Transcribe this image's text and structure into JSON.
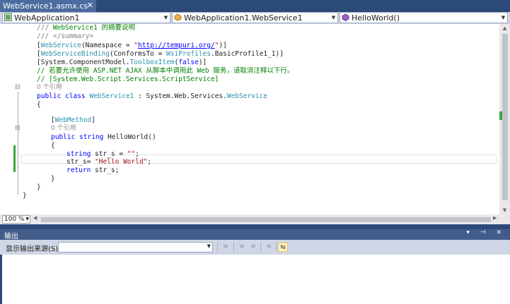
{
  "tab": {
    "title": "WebService1.asmx.cs",
    "close": "✕"
  },
  "nav": {
    "project": "WebApplication1",
    "type": "WebApplication1.WebService1",
    "member": "HelloWorld()"
  },
  "code": {
    "l1": {
      "a": "/// ",
      "b": "WebService1 的摘要说明"
    },
    "l2": "/// </summary>",
    "l3": {
      "a": "[",
      "b": "WebService",
      "c": "(Namespace = ",
      "d": "\"",
      "e": "http://tempuri.org/",
      "f": "\"",
      "g": ")]"
    },
    "l4": {
      "a": "[",
      "b": "WebServiceBinding",
      "c": "(ConformsTo = ",
      "d": "WsiProfiles",
      "e": ".BasicProfile1_1)]"
    },
    "l5": {
      "a": "[System.ComponentModel.",
      "b": "ToolboxItem",
      "c": "(",
      "d": "false",
      "e": ")]"
    },
    "l6": "// 若要允许使用 ASP.NET AJAX 从脚本中调用此 Web 服务，请取消注释以下行。",
    "l7": "// [System.Web.Script.Services.ScriptService]",
    "lens1": "0 个引用",
    "l8": {
      "a": "public class ",
      "b": "WebService1",
      "c": " : System.Web.Services.",
      "d": "WebService"
    },
    "l9": "{",
    "l10": {
      "a": "[",
      "b": "WebMethod",
      "c": "]"
    },
    "lens2": "0 个引用",
    "l11": {
      "a": "public string ",
      "b": "HelloWorld()"
    },
    "l12": "{",
    "l13": {
      "a": "string ",
      "b": "str_s = ",
      "c": "\"\"",
      "d": ";"
    },
    "l14": {
      "a": "str_s= ",
      "b": "\"Hello World\"",
      "c": ";"
    },
    "l15": {
      "a": "return ",
      "b": "str_s;"
    },
    "l16": "}",
    "l17": "}",
    "l18": "}"
  },
  "zoom": "100 %",
  "output": {
    "title": "输出",
    "tools": "▾ ⊣ ✕",
    "source_label": "显示输出来源(S):",
    "source_value": ""
  },
  "colors": {
    "accent": "#2c4a78",
    "change_bar": "#3ea53e",
    "keyword": "#0000ff",
    "type": "#2b91af",
    "comment": "#008000",
    "string": "#a31515"
  }
}
